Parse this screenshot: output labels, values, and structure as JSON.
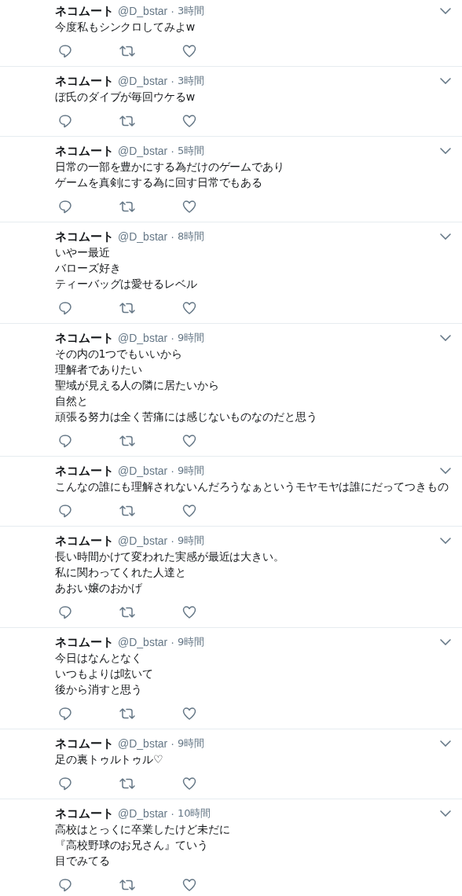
{
  "tweets": [
    {
      "name": "ネコムート",
      "handle": "@D_bstar",
      "dot": "·",
      "time": "3時間",
      "lines": [
        "今度私もシンクロしてみよw"
      ]
    },
    {
      "name": "ネコムート",
      "handle": "@D_bstar",
      "dot": "·",
      "time": "3時間",
      "lines": [
        "ぼ氏のダイブが毎回ウケるw"
      ]
    },
    {
      "name": "ネコムート",
      "handle": "@D_bstar",
      "dot": "·",
      "time": "5時間",
      "lines": [
        "日常の一部を豊かにする為だけのゲームであり",
        "ゲームを真剣にする為に回す日常でもある"
      ]
    },
    {
      "name": "ネコムート",
      "handle": "@D_bstar",
      "dot": "·",
      "time": "8時間",
      "lines": [
        "いやー最近",
        "バローズ好き",
        "ティーバッグは愛せるレベル"
      ]
    },
    {
      "name": "ネコムート",
      "handle": "@D_bstar",
      "dot": "·",
      "time": "9時間",
      "lines": [
        "その内の1つでもいいから",
        "理解者でありたい",
        "聖域が見える人の隣に居たいから",
        "自然と",
        "頑張る努力は全く苦痛には感じないものなのだと思う"
      ]
    },
    {
      "name": "ネコムート",
      "handle": "@D_bstar",
      "dot": "·",
      "time": "9時間",
      "lines": [
        "こんなの誰にも理解されないんだろうなぁというモヤモヤは誰にだってつきもの"
      ]
    },
    {
      "name": "ネコムート",
      "handle": "@D_bstar",
      "dot": "·",
      "time": "9時間",
      "lines": [
        "長い時間かけて変われた実感が最近は大きい。",
        "私に関わってくれた人達と",
        "あおい嬢のおかげ"
      ]
    },
    {
      "name": "ネコムート",
      "handle": "@D_bstar",
      "dot": "·",
      "time": "9時間",
      "lines": [
        "今日はなんとなく",
        "いつもよりは呟いて",
        "後から消すと思う"
      ]
    },
    {
      "name": "ネコムート",
      "handle": "@D_bstar",
      "dot": "·",
      "time": "9時間",
      "lines": [
        "足の裏トゥルトゥル♡"
      ]
    },
    {
      "name": "ネコムート",
      "handle": "@D_bstar",
      "dot": "·",
      "time": "10時間",
      "lines": [
        "高校はとっくに卒業したけど未だに",
        "『高校野球のお兄さん』ていう",
        "目でみてる"
      ]
    }
  ]
}
